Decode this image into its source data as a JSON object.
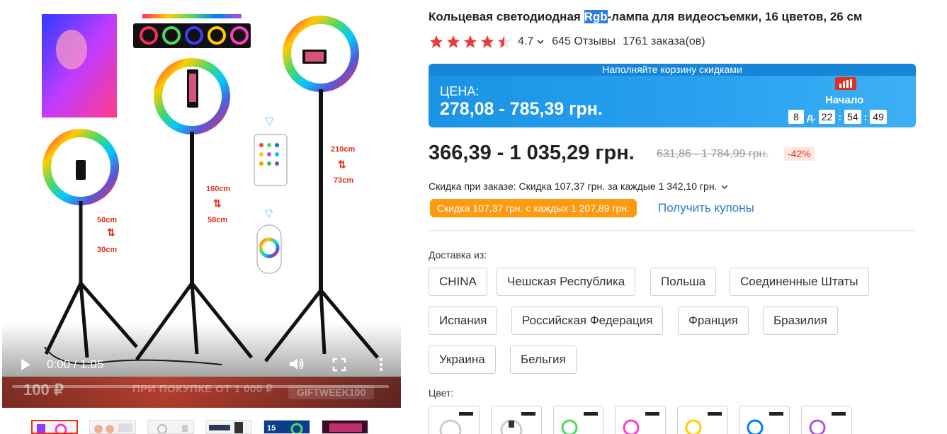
{
  "product": {
    "title_before": "Кольцевая светодиодная ",
    "title_highlight": "Rgb",
    "title_after": "-лампа для видеосъемки, 16 цветов, 26 см",
    "rating": "4.7",
    "reviews": "645 Отзывы",
    "orders": "1761 заказа(ов)"
  },
  "sale_banner": {
    "header": "Наполняйте корзину скидками",
    "label": "ЦЕНА:",
    "price": "278,08 - 785,39 грн.",
    "timer_label": "Начало",
    "timer": {
      "days": "8",
      "days_unit": "д.",
      "hours": "22",
      "minutes": "54",
      "seconds": "49"
    }
  },
  "pricing": {
    "price": "366,39 - 1 035,29 грн.",
    "old_price": "631,86 - 1 784,99 грн.",
    "discount": "-42%",
    "order_discount": "Скидка при заказе: Скидка 107,37 грн. за каждые 1 342,10 грн.",
    "coupon_tag": "Скидка 107,37 грн. с каждых 1 207,89 грн.",
    "coupon_link": "Получить купоны"
  },
  "shipping": {
    "label": "Доставка из:",
    "options": [
      "CHINA",
      "Чешская Республика",
      "Польша",
      "Соединенные Штаты",
      "Испания",
      "Российская Федерация",
      "Франция",
      "Бразилия",
      "Украина",
      "Бельгия"
    ]
  },
  "color": {
    "label": "Цвет:"
  },
  "video": {
    "time": "0:00 / 1:05",
    "promo_price": "100 ₽",
    "promo_text": "ПРИ ПОКУПКЕ ОТ 1 000 ₽",
    "promo_code": "GIFTWEEK100",
    "labels": {
      "small_top": "50cm",
      "small_bottom": "30cm",
      "mid_top": "160cm",
      "mid_bottom": "58cm",
      "tall_top": "210cm",
      "tall_bottom": "73cm"
    }
  },
  "colors": {
    "accent": "#e0301e",
    "banner": "#1a93e6",
    "coupon": "#ff9a0f",
    "link": "#2b7cc9",
    "star": "#f0393d"
  }
}
